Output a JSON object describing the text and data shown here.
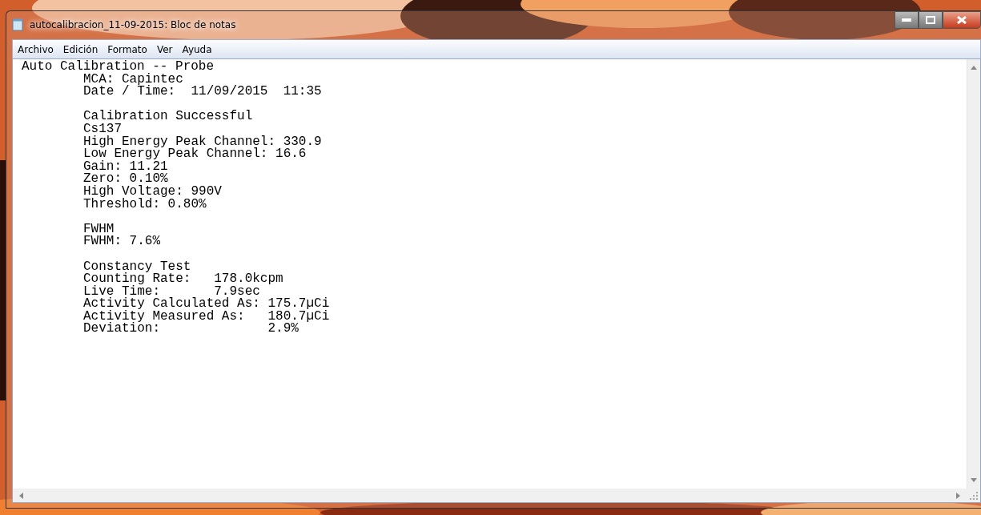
{
  "window": {
    "title": "autocalibracion_11-09-2015: Bloc de notas"
  },
  "menu": [
    "Archivo",
    "Edición",
    "Formato",
    "Ver",
    "Ayuda"
  ],
  "document": {
    "heading": "Auto Calibration -- Probe",
    "sections": [
      [
        "MCA: Capintec",
        "Date / Time:  11/09/2015  11:35"
      ],
      [
        "Calibration Successful",
        "Cs137",
        "High Energy Peak Channel: 330.9",
        "Low Energy Peak Channel: 16.6",
        "Gain: 11.21",
        "Zero: 0.10%",
        "High Voltage: 990V",
        "Threshold: 0.80%"
      ],
      [
        "FWHM",
        "FWHM: 7.6%"
      ],
      [
        "Constancy Test",
        "Counting Rate:   178.0kcpm",
        "Live Time:       7.9sec",
        "Activity Calculated As: 175.7µCi",
        "Activity Measured As:   180.7µCi",
        "Deviation:              2.9%"
      ]
    ]
  }
}
